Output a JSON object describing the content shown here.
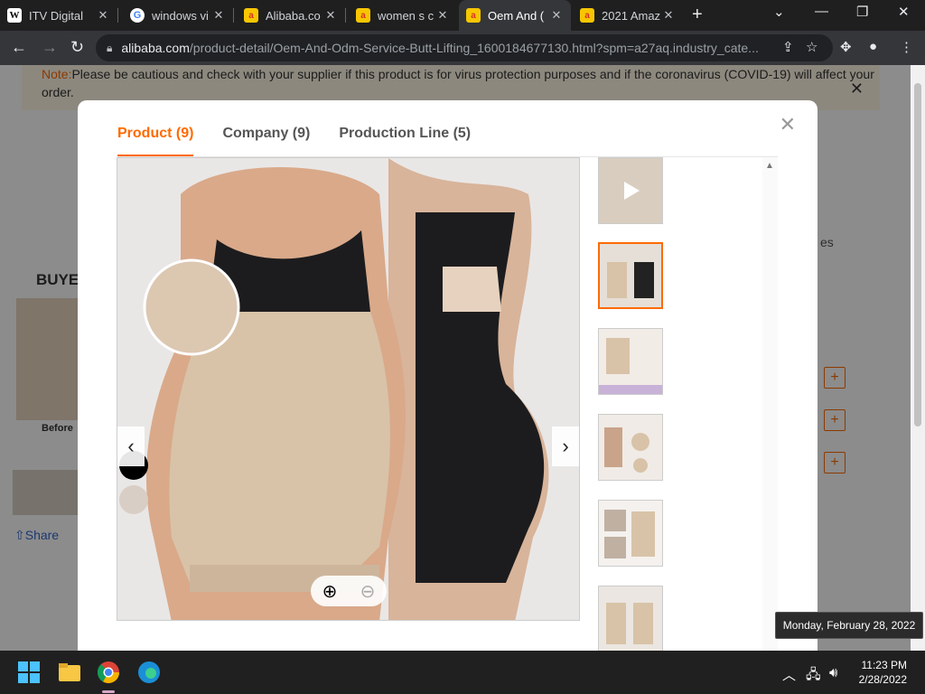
{
  "tabs": [
    {
      "title": "ITV Digital",
      "favicon": "w-favicon"
    },
    {
      "title": "windows vi",
      "favicon": "google-favicon"
    },
    {
      "title": "Alibaba.co",
      "favicon": "alibaba-favicon"
    },
    {
      "title": "women s c",
      "favicon": "alibaba-favicon"
    },
    {
      "title": "Oem And (",
      "favicon": "alibaba-favicon",
      "active": true
    },
    {
      "title": "2021 Amaz",
      "favicon": "alibaba-favicon"
    }
  ],
  "address": {
    "domain": "alibaba.com",
    "path": "/product-detail/Oem-And-Odm-Service-Butt-Lifting_1600184677130.html?spm=a27aq.industry_cate..."
  },
  "notice": {
    "prefix": "Note:",
    "text": "Please be cautious and check with your supplier if this product is for virus protection purposes and if the coronavirus (COVID-19) will affect your order."
  },
  "background": {
    "buyer_label": "BUYE",
    "before_label": "Before",
    "share_label": "Share",
    "side_text": "es"
  },
  "modal": {
    "tabs": [
      {
        "label": "Product (9)",
        "active": true
      },
      {
        "label": "Company (9)"
      },
      {
        "label": "Production Line (5)"
      }
    ]
  },
  "taskbar": {
    "time": "11:23 PM",
    "date": "2/28/2022",
    "tooltip": "Monday, February 28, 2022"
  },
  "colors": {
    "accent": "#ff6a00",
    "tab_bar": "#1f1f1f",
    "toolbar": "#35363a"
  }
}
